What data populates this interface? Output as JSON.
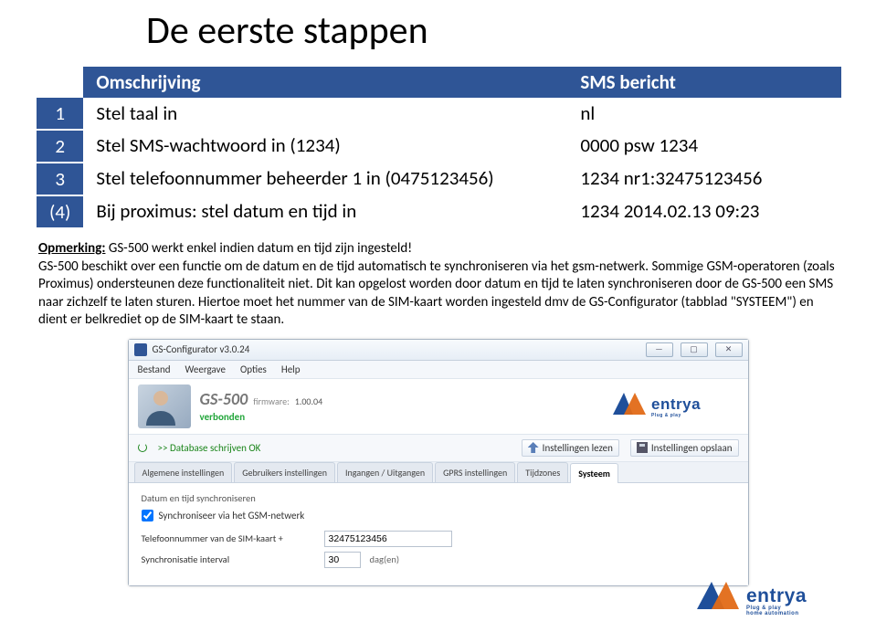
{
  "title": "De eerste stappen",
  "table": {
    "header_desc": "Omschrijving",
    "header_sms": "SMS bericht",
    "rows": [
      {
        "num": "1",
        "desc": "Stel taal in",
        "sms": "nl"
      },
      {
        "num": "2",
        "desc": "Stel SMS-wachtwoord in (1234)",
        "sms": "0000 psw 1234"
      },
      {
        "num": "3",
        "desc": "Stel telefoonnummer beheerder 1 in (0475123456)",
        "sms": "1234 nr1:32475123456"
      },
      {
        "num": "(4)",
        "desc": "Bij proximus: stel datum en tijd in",
        "sms": "1234 2014.02.13 09:23"
      }
    ]
  },
  "remark": {
    "label": "Opmerking:",
    "line1": "GS-500 werkt enkel indien datum en tijd zijn ingesteld!",
    "body": "GS-500 beschikt over een functie om de datum en de tijd automatisch te synchroniseren via het gsm-netwerk. Sommige GSM-operatoren (zoals Proximus) ondersteunen deze functionaliteit niet. Dit kan opgelost worden door datum en tijd te laten synchroniseren door de GS-500 een SMS naar zichzelf te laten sturen. Hiertoe moet het nummer van de SIM-kaart worden ingesteld dmv de GS-Configurator (tabblad \"SYSTEEM\") en dient er belkrediet op de SIM-kaart te staan."
  },
  "app": {
    "title": "GS-Configurator v3.0.24",
    "menu": [
      "Bestand",
      "Weergave",
      "Opties",
      "Help"
    ],
    "model": "GS-500",
    "fw_label": "firmware:",
    "fw_value": "1.00.04",
    "connected": "verbonden",
    "toolbar_status": ">> Database schrijven OK",
    "btn_lezen": "Instellingen lezen",
    "btn_opslaan": "Instellingen opslaan",
    "tabs": [
      "Algemene instellingen",
      "Gebruikers instellingen",
      "Ingangen / Uitgangen",
      "GPRS instellingen",
      "Tijdzones",
      "Systeem"
    ],
    "panel_title": "Datum en tijd synchroniseren",
    "checkbox": "Synchroniseer via het GSM-netwerk",
    "field_tel_label": "Telefoonnummer van de SIM-kaart   +",
    "field_tel_value": "32475123456",
    "field_int_label": "Synchronisatie interval",
    "field_int_value": "30",
    "field_int_unit": "dag(en)"
  },
  "brand": {
    "name": "entrya",
    "tagline1": "Plug & play",
    "tagline2": "home automation"
  }
}
